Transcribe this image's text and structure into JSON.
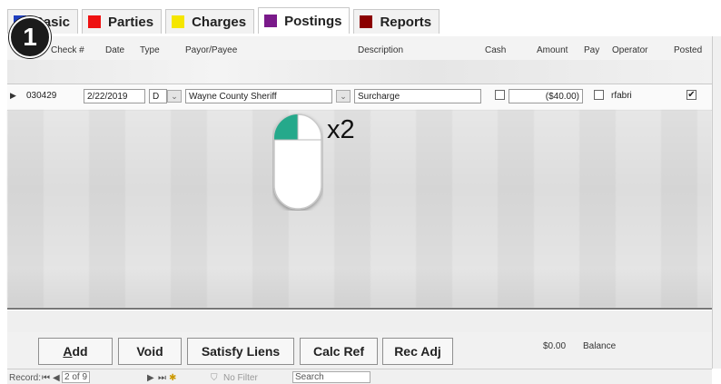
{
  "tabs": [
    {
      "label": "Basic",
      "color": "#1f3fbf"
    },
    {
      "label": "Parties",
      "color": "#ee1111"
    },
    {
      "label": "Charges",
      "color": "#f5e600"
    },
    {
      "label": "Postings",
      "color": "#7a1a8a"
    },
    {
      "label": "Reports",
      "color": "#8b0000"
    }
  ],
  "columns": {
    "check": "Check #",
    "date": "Date",
    "type": "Type",
    "payor": "Payor/Payee",
    "description": "Description",
    "cash": "Cash",
    "amount": "Amount",
    "pay": "Pay",
    "operator": "Operator",
    "posted": "Posted"
  },
  "row": {
    "check": "030429",
    "date": "2/22/2019",
    "type": "D",
    "payor": "Wayne County Sheriff",
    "description": "Surcharge",
    "amount": "($40.00)",
    "operator": "rfabri",
    "posted_mark": "✔"
  },
  "buttons": {
    "add_underline": "A",
    "add_rest": "dd",
    "void": "Void",
    "satisfy": "Satisfy Liens",
    "calc": "Calc Ref",
    "recadj": "Rec Adj"
  },
  "balance": {
    "value": "$0.00",
    "label": "Balance"
  },
  "navigation": {
    "record_label": "Record:",
    "record_pos": "2 of 9",
    "filter": "No Filter",
    "search": "Search"
  },
  "overlay": {
    "step": "1",
    "click_count": "x2"
  }
}
